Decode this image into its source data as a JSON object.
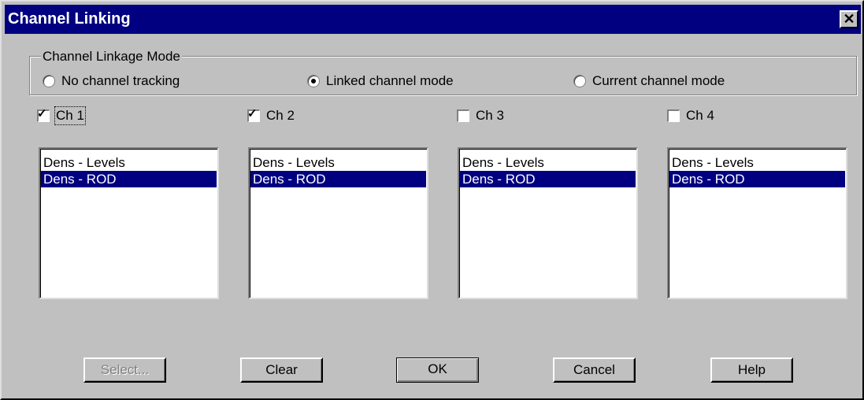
{
  "window": {
    "title": "Channel Linking"
  },
  "linkage_mode": {
    "label": "Channel Linkage Mode",
    "options": [
      {
        "label": "No channel tracking",
        "selected": false
      },
      {
        "label": "Linked channel mode",
        "selected": true
      },
      {
        "label": "Current channel mode",
        "selected": false
      }
    ]
  },
  "channels": [
    {
      "label": "Ch 1",
      "checked": true,
      "items": [
        "Dens - Levels",
        "Dens - ROD"
      ],
      "selected_item": "Dens - ROD"
    },
    {
      "label": "Ch 2",
      "checked": true,
      "items": [
        "Dens - Levels",
        "Dens - ROD"
      ],
      "selected_item": "Dens - ROD"
    },
    {
      "label": "Ch 3",
      "checked": false,
      "items": [
        "Dens - Levels",
        "Dens - ROD"
      ],
      "selected_item": "Dens - ROD"
    },
    {
      "label": "Ch 4",
      "checked": false,
      "items": [
        "Dens - Levels",
        "Dens - ROD"
      ],
      "selected_item": "Dens - ROD"
    }
  ],
  "buttons": {
    "select": "Select...",
    "clear": "Clear",
    "ok": "OK",
    "cancel": "Cancel",
    "help": "Help"
  },
  "colors": {
    "titlebar": "#000080",
    "face": "#c0c0c0",
    "selection": "#000080"
  },
  "icons": {
    "close": "close-icon"
  }
}
